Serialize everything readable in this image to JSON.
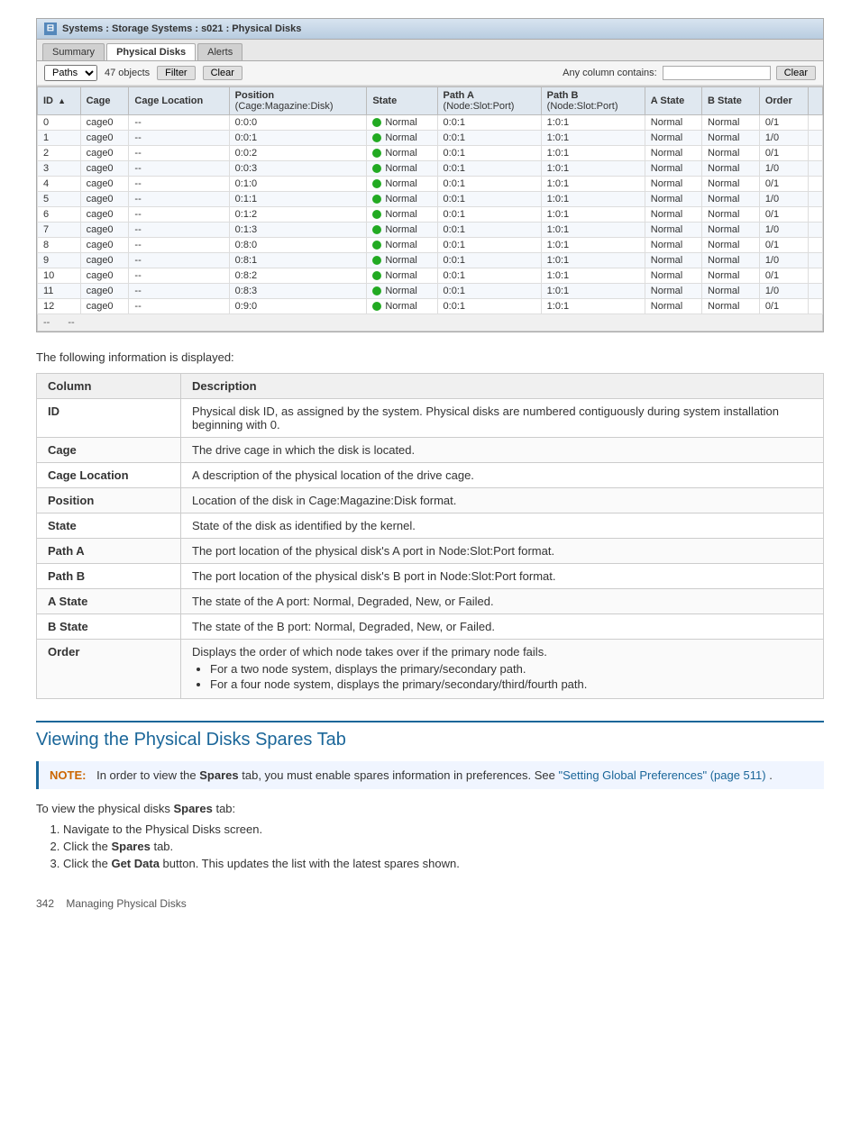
{
  "window": {
    "title": "Systems : Storage Systems : s021 : Physical Disks",
    "tabs": [
      "Summary",
      "Physical Disks",
      "Alerts"
    ],
    "active_tab": "Physical Disks"
  },
  "toolbar": {
    "dropdown_label": "Paths",
    "objects_count": "47 objects",
    "filter_btn": "Filter",
    "clear_btn": "Clear",
    "any_column_label": "Any column contains:",
    "clear_filter_btn": "Clear"
  },
  "table": {
    "columns": [
      "ID",
      "Cage",
      "Cage Location",
      "Position\n(Cage:Magazine:Disk)",
      "State",
      "Path A\n(Node:Slot:Port)",
      "Path B\n(Node:Slot:Port)",
      "A State",
      "B State",
      "Order"
    ],
    "rows": [
      {
        "id": "0",
        "cage": "cage0",
        "cage_loc": "--",
        "position": "0:0:0",
        "state": "Normal",
        "path_a": "0:0:1",
        "path_b": "1:0:1",
        "a_state": "Normal",
        "b_state": "Normal",
        "order": "0/1"
      },
      {
        "id": "1",
        "cage": "cage0",
        "cage_loc": "--",
        "position": "0:0:1",
        "state": "Normal",
        "path_a": "0:0:1",
        "path_b": "1:0:1",
        "a_state": "Normal",
        "b_state": "Normal",
        "order": "1/0"
      },
      {
        "id": "2",
        "cage": "cage0",
        "cage_loc": "--",
        "position": "0:0:2",
        "state": "Normal",
        "path_a": "0:0:1",
        "path_b": "1:0:1",
        "a_state": "Normal",
        "b_state": "Normal",
        "order": "0/1"
      },
      {
        "id": "3",
        "cage": "cage0",
        "cage_loc": "--",
        "position": "0:0:3",
        "state": "Normal",
        "path_a": "0:0:1",
        "path_b": "1:0:1",
        "a_state": "Normal",
        "b_state": "Normal",
        "order": "1/0"
      },
      {
        "id": "4",
        "cage": "cage0",
        "cage_loc": "--",
        "position": "0:1:0",
        "state": "Normal",
        "path_a": "0:0:1",
        "path_b": "1:0:1",
        "a_state": "Normal",
        "b_state": "Normal",
        "order": "0/1"
      },
      {
        "id": "5",
        "cage": "cage0",
        "cage_loc": "--",
        "position": "0:1:1",
        "state": "Normal",
        "path_a": "0:0:1",
        "path_b": "1:0:1",
        "a_state": "Normal",
        "b_state": "Normal",
        "order": "1/0"
      },
      {
        "id": "6",
        "cage": "cage0",
        "cage_loc": "--",
        "position": "0:1:2",
        "state": "Normal",
        "path_a": "0:0:1",
        "path_b": "1:0:1",
        "a_state": "Normal",
        "b_state": "Normal",
        "order": "0/1"
      },
      {
        "id": "7",
        "cage": "cage0",
        "cage_loc": "--",
        "position": "0:1:3",
        "state": "Normal",
        "path_a": "0:0:1",
        "path_b": "1:0:1",
        "a_state": "Normal",
        "b_state": "Normal",
        "order": "1/0"
      },
      {
        "id": "8",
        "cage": "cage0",
        "cage_loc": "--",
        "position": "0:8:0",
        "state": "Normal",
        "path_a": "0:0:1",
        "path_b": "1:0:1",
        "a_state": "Normal",
        "b_state": "Normal",
        "order": "0/1"
      },
      {
        "id": "9",
        "cage": "cage0",
        "cage_loc": "--",
        "position": "0:8:1",
        "state": "Normal",
        "path_a": "0:0:1",
        "path_b": "1:0:1",
        "a_state": "Normal",
        "b_state": "Normal",
        "order": "1/0"
      },
      {
        "id": "10",
        "cage": "cage0",
        "cage_loc": "--",
        "position": "0:8:2",
        "state": "Normal",
        "path_a": "0:0:1",
        "path_b": "1:0:1",
        "a_state": "Normal",
        "b_state": "Normal",
        "order": "0/1"
      },
      {
        "id": "11",
        "cage": "cage0",
        "cage_loc": "--",
        "position": "0:8:3",
        "state": "Normal",
        "path_a": "0:0:1",
        "path_b": "1:0:1",
        "a_state": "Normal",
        "b_state": "Normal",
        "order": "1/0"
      },
      {
        "id": "12",
        "cage": "cage0",
        "cage_loc": "--",
        "position": "0:9:0",
        "state": "Normal",
        "path_a": "0:0:1",
        "path_b": "1:0:1",
        "a_state": "Normal",
        "b_state": "Normal",
        "order": "0/1"
      }
    ],
    "footer_cols": [
      "--",
      "--"
    ]
  },
  "info_text": "The following information is displayed:",
  "desc_table": {
    "header_col": "Column",
    "header_desc": "Description",
    "rows": [
      {
        "col": "ID",
        "desc": "Physical disk ID, as assigned by the system. Physical disks are numbered contiguously during system installation beginning with 0.",
        "bullets": []
      },
      {
        "col": "Cage",
        "desc": "The drive cage in which the disk is located.",
        "bullets": []
      },
      {
        "col": "Cage Location",
        "desc": "A description of the physical location of the drive cage.",
        "bullets": []
      },
      {
        "col": "Position",
        "desc": "Location of the disk in Cage:Magazine:Disk format.",
        "bullets": []
      },
      {
        "col": "State",
        "desc": "State of the disk as identified by the kernel.",
        "bullets": []
      },
      {
        "col": "Path A",
        "desc": "The port location of the physical disk's A port in Node:Slot:Port format.",
        "bullets": []
      },
      {
        "col": "Path B",
        "desc": "The port location of the physical disk's B port in Node:Slot:Port format.",
        "bullets": []
      },
      {
        "col": "A State",
        "desc": "The state of the A port: Normal, Degraded, New, or Failed.",
        "bullets": []
      },
      {
        "col": "B State",
        "desc": "The state of the B port: Normal, Degraded, New, or Failed.",
        "bullets": []
      },
      {
        "col": "Order",
        "desc": "Displays the order of which node takes over if the primary node fails.",
        "bullets": [
          "For a two node system, displays the primary/secondary path.",
          "For a four node system, displays the primary/secondary/third/fourth path."
        ]
      }
    ]
  },
  "section_heading": "Viewing the Physical Disks Spares Tab",
  "note": {
    "label": "NOTE:",
    "text": "In order to view the",
    "bold_word": "Spares",
    "text2": "tab, you must enable spares information in preferences. See",
    "link_text": "\"Setting Global Preferences\" (page 511)",
    "text3": "."
  },
  "steps_intro": "To view the physical disks",
  "steps_bold": "Spares",
  "steps_intro2": "tab:",
  "steps": [
    "Navigate to the Physical Disks screen.",
    "Click the <b>Spares</b> tab.",
    "Click the <b>Get Data</b> button. This updates the list with the latest spares shown."
  ],
  "page_footer": {
    "page_num": "342",
    "text": "Managing Physical Disks"
  }
}
